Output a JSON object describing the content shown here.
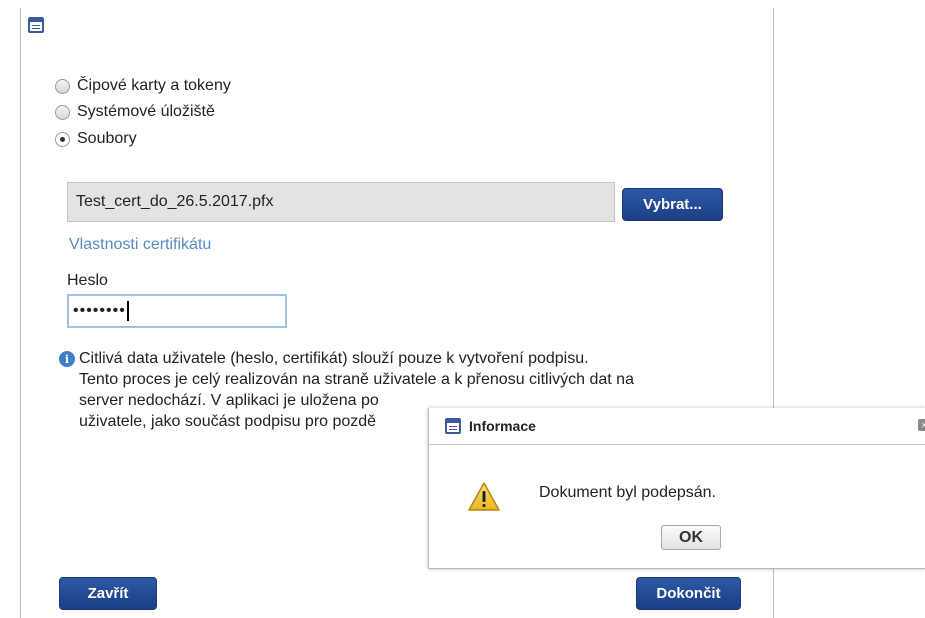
{
  "main_dialog": {
    "options": [
      {
        "label": "Čipové karty a tokeny",
        "checked": false
      },
      {
        "label": "Systémové úložiště",
        "checked": false
      },
      {
        "label": "Soubory",
        "checked": true
      }
    ],
    "file_name": "Test_cert_do_26.5.2017.pfx",
    "choose_button": "Vybrat...",
    "cert_properties_link": "Vlastnosti certifikátu",
    "password_label": "Heslo",
    "password_value": "••••••••",
    "info_lines": [
      "Citlivá data uživatele (heslo, certifikát) slouží pouze k vytvoření podpisu.",
      "Tento proces je celý realizován na straně uživatele a k přenosu citlivých dat na",
      "server nedochází. V aplikaci je uložena po",
      "uživatele, jako součást podpisu pro pozdě"
    ],
    "close_button": "Zavřít",
    "finish_button": "Dokončit"
  },
  "popup": {
    "title": "Informace",
    "message": "Dokument byl podepsán.",
    "ok_button": "OK"
  },
  "colors": {
    "accent_blue": "#1f438c",
    "link": "#5a8ac2",
    "info_icon": "#3f7fc6",
    "warning": "#f1c232"
  }
}
